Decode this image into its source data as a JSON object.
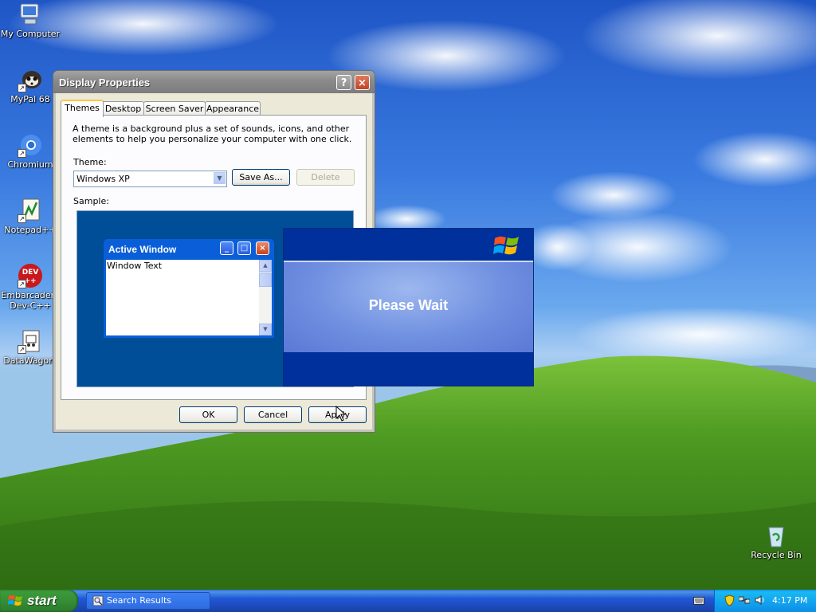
{
  "desktop": {
    "icons": [
      {
        "label": "My Computer",
        "icon": "my-computer-icon"
      },
      {
        "label": "MyPal 68",
        "icon": "mypal-browser-icon"
      },
      {
        "label": "Chromium",
        "icon": "chromium-icon"
      },
      {
        "label": "Notepad++",
        "icon": "notepadpp-icon"
      },
      {
        "label": "Embarcadero Dev-C++",
        "line1": "Embarcadero",
        "line2": "Dev-C++",
        "icon": "dev-cpp-icon"
      },
      {
        "label": "DataWagon.",
        "icon": "datawagon-icon"
      },
      {
        "label": "Recycle Bin",
        "icon": "recycle-bin-icon"
      }
    ]
  },
  "display_properties": {
    "title": "Display Properties",
    "help_button": "?",
    "close_button": "×",
    "tabs": [
      "Themes",
      "Desktop",
      "Screen Saver",
      "Appearance"
    ],
    "active_tab": "Themes",
    "description": "A theme is a background plus a set of sounds, icons, and other elements to help you personalize your computer with one click.",
    "theme_label": "Theme:",
    "theme_value": "Windows XP",
    "save_as": "Save As...",
    "delete": "Delete",
    "sample_label": "Sample:",
    "sample_window": {
      "title": "Active Window",
      "text": "Window Text"
    },
    "ok": "OK",
    "cancel": "Cancel",
    "apply": "Apply"
  },
  "please_wait": {
    "message": "Please Wait"
  },
  "taskbar": {
    "start": "start",
    "item": "Search Results",
    "clock": "4:17 PM"
  },
  "colors": {
    "sky": "#3a7be0",
    "grass": "#3d8a1c",
    "taskbar": "#245edb",
    "start_green": "#379237",
    "dialog_face": "#ece9d8",
    "please_wait_blue": "#00309c"
  }
}
